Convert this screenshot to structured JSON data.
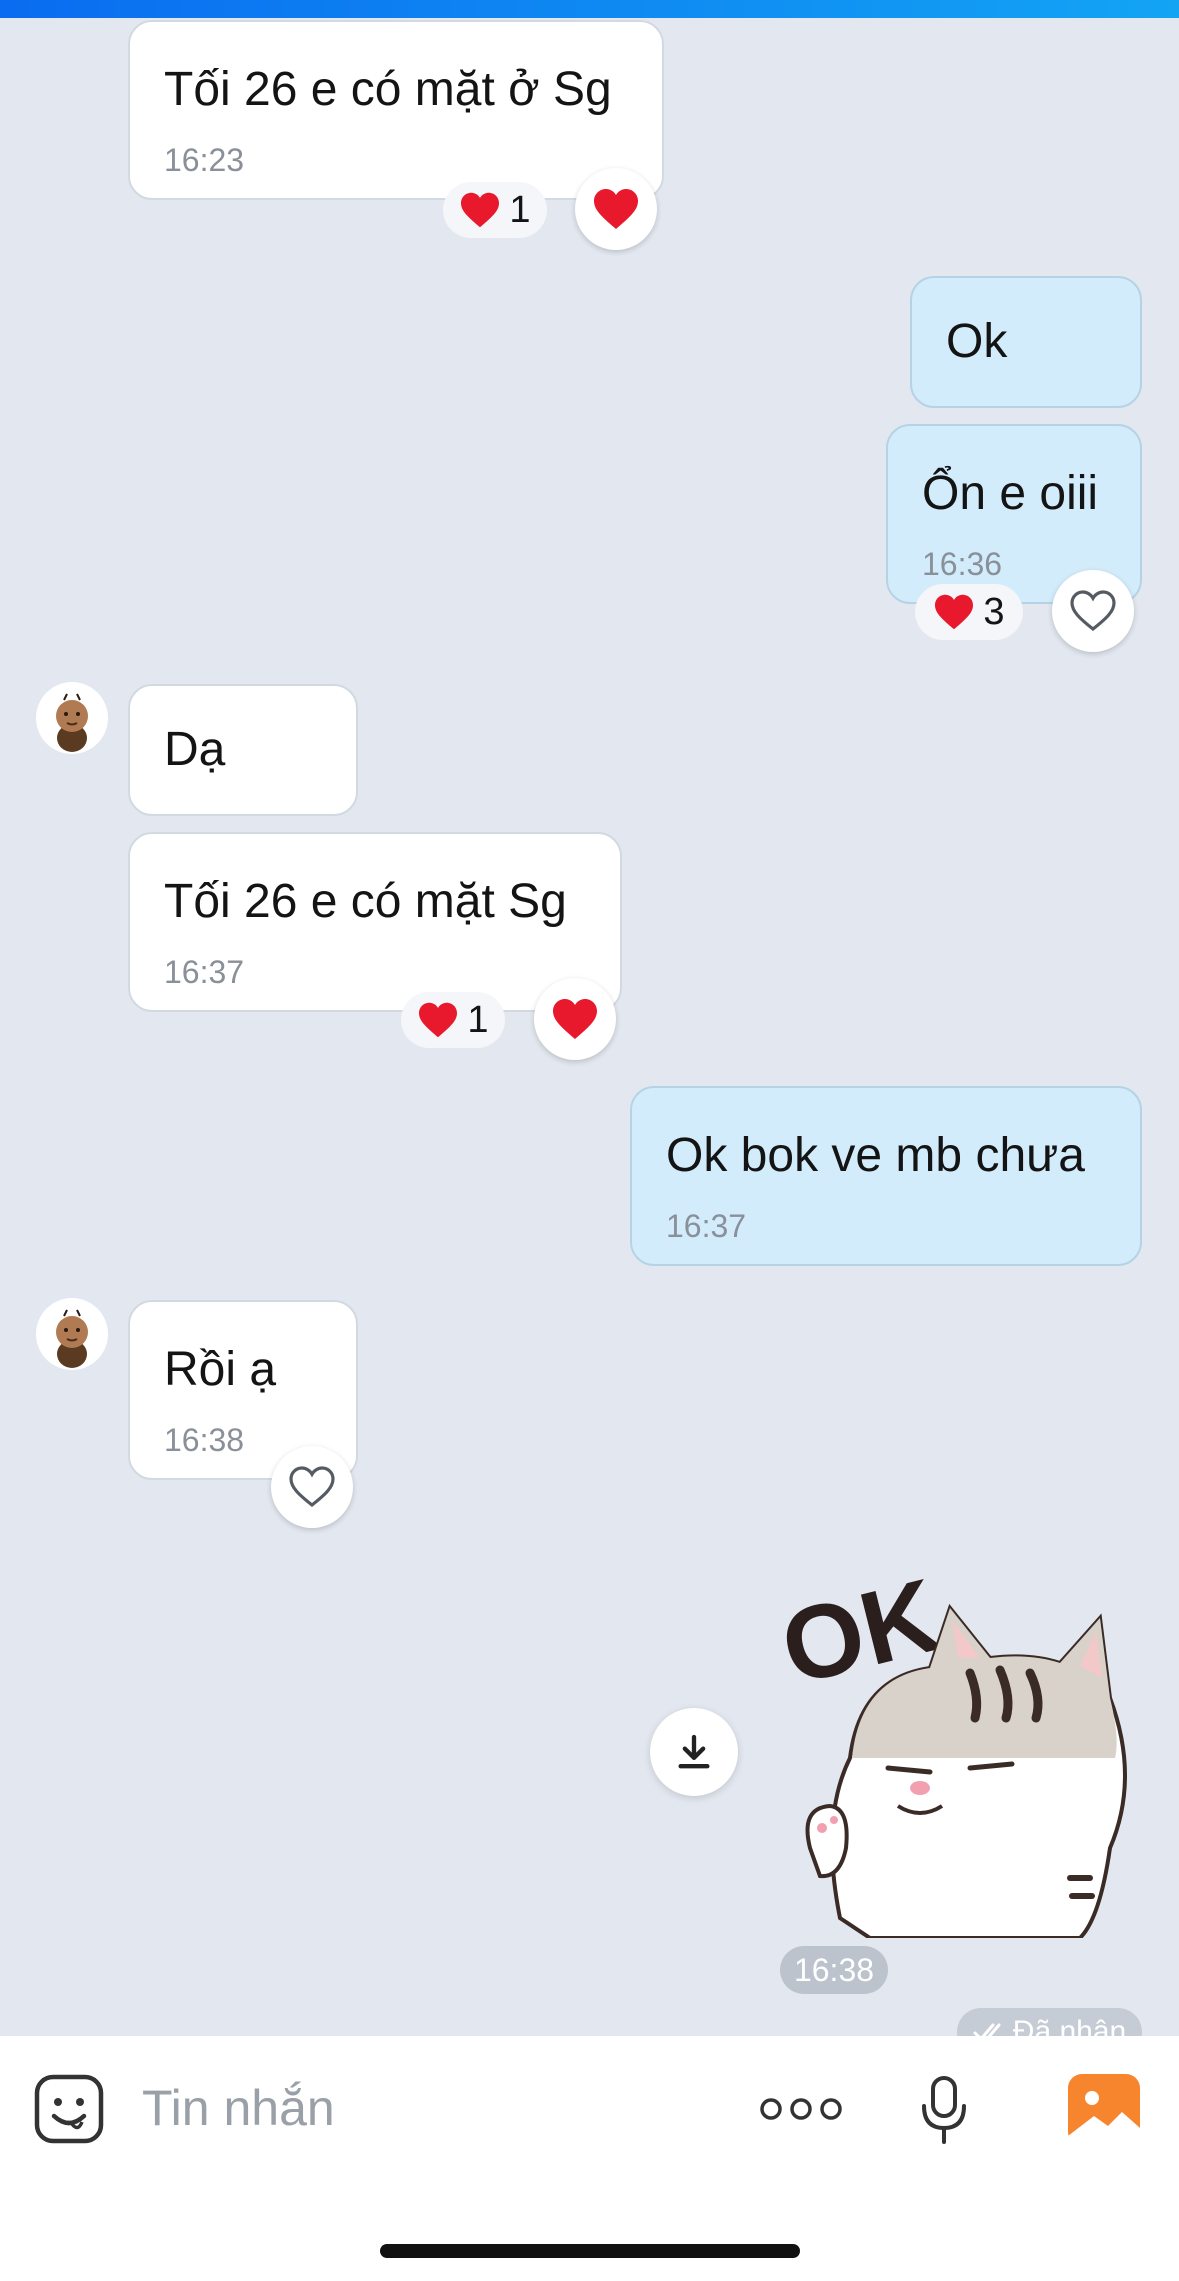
{
  "messages": [
    {
      "text": "Tối 26 e có mặt ở Sg",
      "time": "16:23",
      "reaction_count": "1"
    },
    {
      "text": "Ok"
    },
    {
      "text": "Ổn e oiii",
      "time": "16:36",
      "reaction_count": "3"
    },
    {
      "text": "Dạ"
    },
    {
      "text": "Tối 26 e có mặt Sg",
      "time": "16:37",
      "reaction_count": "1"
    },
    {
      "text": "Ok bok ve mb chưa",
      "time": "16:37"
    },
    {
      "text": "Rồi ạ",
      "time": "16:38"
    }
  ],
  "sticker": {
    "text": "OK",
    "time": "16:38"
  },
  "status": {
    "label": "Đã nhận"
  },
  "input": {
    "placeholder": "Tin nhắn"
  },
  "icons": {
    "reaction_heart": "heart-icon",
    "like": "heart-outline-icon",
    "download": "download-icon",
    "emoji": "sticker-face-icon",
    "more": "more-dots-icon",
    "mic": "microphone-icon",
    "gallery": "image-gallery-icon",
    "delivered": "double-check-icon"
  },
  "colors": {
    "background": "#e3e8f0",
    "incoming_bubble": "#ffffff",
    "outgoing_bubble": "#d2ecfc",
    "heart": "#e8192c",
    "accent_bar": "#0a6cf0",
    "gallery_icon": "#f7852e"
  }
}
